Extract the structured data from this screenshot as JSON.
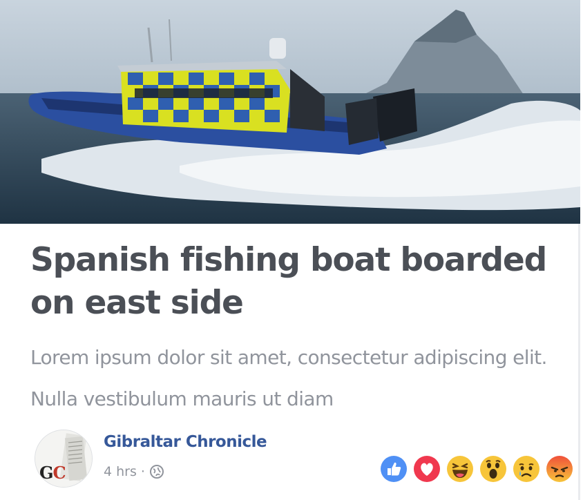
{
  "post": {
    "headline": "Spanish fishing boat boarded on east side",
    "summary": "Lorem ipsum dolor sit amet, consectetur adipiscing elit. Nulla vestibulum mauris ut diam",
    "page_name": "Gibraltar Chronicle",
    "avatar_initials": {
      "g": "G",
      "c": "C"
    },
    "timestamp": "4 hrs",
    "separator": "·",
    "audience_icon": "globe-icon"
  },
  "hero_image": {
    "subject": "police-patrol-boat-icon",
    "colors": {
      "sky": "#b7c5d2",
      "sea": "#2d4556",
      "spray": "#eef2f5",
      "hull": "#2b4fa0",
      "check_yellow": "#d9e021",
      "check_blue": "#2f5fb0"
    }
  },
  "reactions": [
    {
      "name": "like-reaction-icon",
      "color": "#4f90f5"
    },
    {
      "name": "love-reaction-icon",
      "color": "#f0384e"
    },
    {
      "name": "haha-reaction-icon",
      "color": "#f7c53a"
    },
    {
      "name": "wow-reaction-icon",
      "color": "#f7c53a"
    },
    {
      "name": "sad-reaction-icon",
      "color": "#f7c53a"
    },
    {
      "name": "angry-reaction-icon",
      "color": "#f06a3a"
    }
  ],
  "colors": {
    "headline": "#4b4f56",
    "summary": "#90949c",
    "link": "#365899"
  }
}
